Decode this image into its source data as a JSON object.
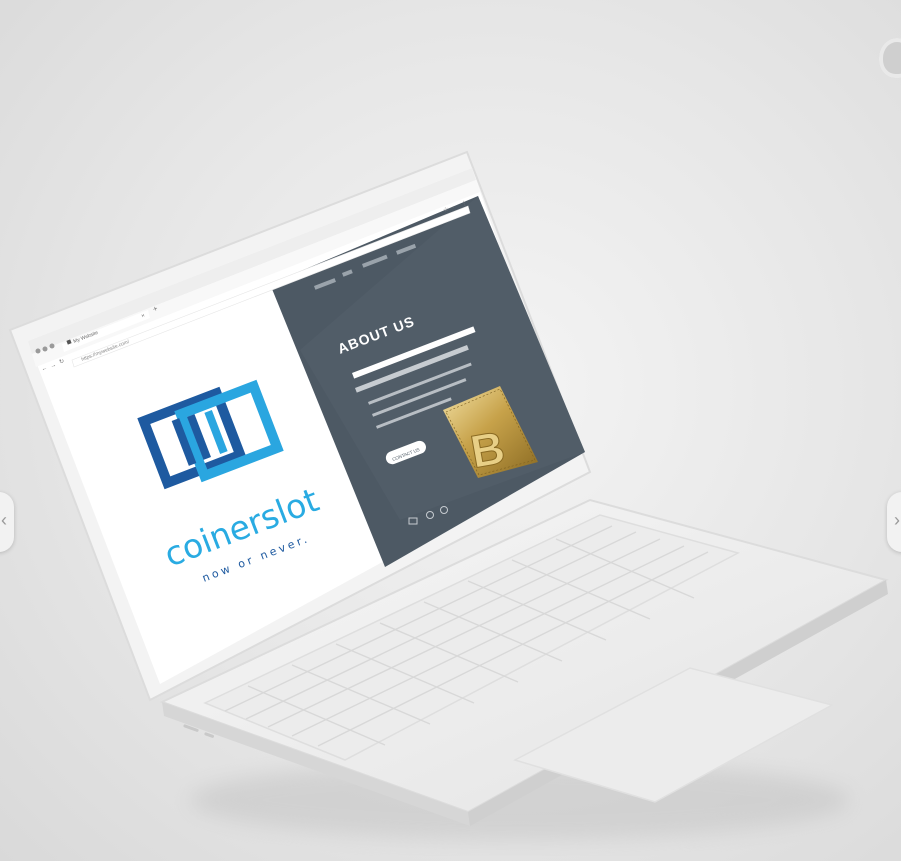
{
  "browser": {
    "tab_title": "My Website",
    "url": "https://mywebsite.com/",
    "new_tab_symbol": "+",
    "close_tab_symbol": "×"
  },
  "hero": {
    "brand_name": "coinerslot",
    "tagline": "now or never.",
    "brand_color": "#29abe2",
    "logo_dark": "#1e5aa0",
    "logo_light": "#2aa6e0"
  },
  "about": {
    "title": "ABOUT US",
    "cta_label": "CONTACT US",
    "panel_color": "#4d5964",
    "coin_icon": "bitcoin-coin-icon"
  },
  "icons": [
    "mail-icon",
    "location-pin-icon",
    "whatsapp-icon",
    "chevron-left-icon",
    "chevron-right-icon"
  ]
}
